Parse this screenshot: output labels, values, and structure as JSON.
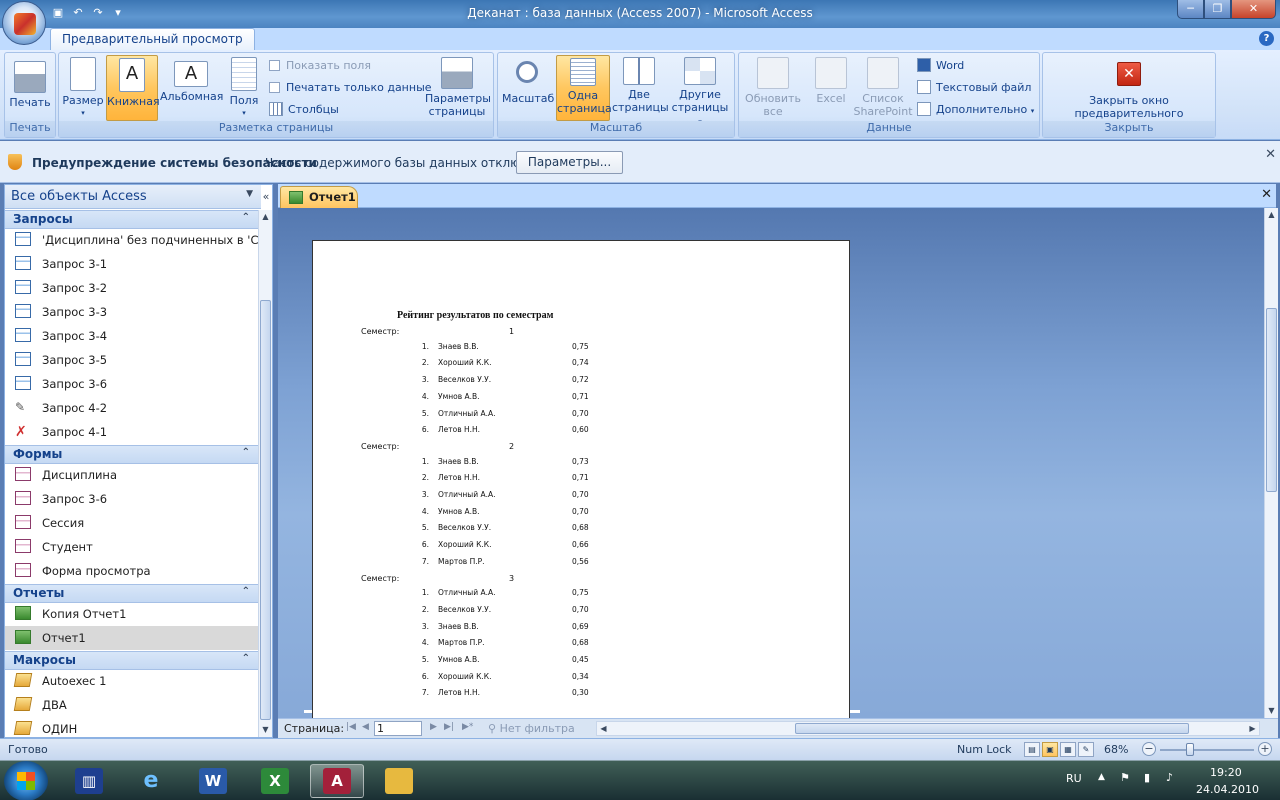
{
  "window": {
    "title": "Деканат : база данных (Access 2007) - Microsoft Access",
    "minimize": "─",
    "restore": "❐",
    "close": "✕"
  },
  "ribbon": {
    "tab": "Предварительный просмотр",
    "groups": {
      "print": {
        "label": "Печать",
        "print_btn": "Печать"
      },
      "layout": {
        "label": "Разметка страницы",
        "size_btn": "Размер",
        "portrait_btn": "Книжная",
        "landscape_btn": "Альбомная",
        "margins_btn": "Поля",
        "show_margins": "Показать поля",
        "print_data_only": "Печатать только данные",
        "columns": "Столбцы",
        "page_setup_line1": "Параметры",
        "page_setup_line2": "страницы"
      },
      "zoom": {
        "label": "Масштаб",
        "zoom_btn": "Масштаб",
        "one_page_line1": "Одна",
        "one_page_line2": "страница",
        "two_pages_line1": "Две",
        "two_pages_line2": "страницы",
        "more_pages_line1": "Другие",
        "more_pages_line2": "страницы"
      },
      "data": {
        "label": "Данные",
        "refresh_line1": "Обновить",
        "refresh_line2": "все",
        "excel": "Excel",
        "sharepoint_line1": "Список",
        "sharepoint_line2": "SharePoint",
        "word": "Word",
        "text_file": "Текстовый файл",
        "more": "Дополнительно"
      },
      "close": {
        "label": "Закрыть",
        "close_line1": "Закрыть окно",
        "close_line2": "предварительного просмотра"
      }
    }
  },
  "security": {
    "title": "Предупреждение системы безопасности",
    "message": "Часть содержимого базы данных отключено",
    "options_btn": "Параметры..."
  },
  "navpane": {
    "header": "Все объекты Access",
    "sections": [
      {
        "title": "Запросы",
        "items": [
          "'Дисциплина' без подчиненных в 'Се...",
          "Запрос 3-1",
          "Запрос 3-2",
          "Запрос 3-3",
          "Запрос 3-4",
          "Запрос 3-5",
          "Запрос 3-6",
          "Запрос 4-2",
          "Запрос 4-1"
        ]
      },
      {
        "title": "Формы",
        "items": [
          "Дисциплина",
          "Запрос 3-6",
          "Сессия",
          "Студент",
          "Форма просмотра"
        ]
      },
      {
        "title": "Отчеты",
        "items": [
          "Копия Отчет1",
          "Отчет1"
        ]
      },
      {
        "title": "Макросы",
        "items": [
          "Autoexec 1",
          "ДВА",
          "ОДИН"
        ]
      }
    ]
  },
  "document": {
    "tab": "Отчет1",
    "report": {
      "title": "Рейтинг результатов по семестрам",
      "semester_label": "Семестр:",
      "semesters": [
        {
          "num": "1",
          "rows": [
            {
              "n": "1.",
              "name": "Знаев В.В.",
              "v": "0,75"
            },
            {
              "n": "2.",
              "name": "Хороший К.К.",
              "v": "0,74"
            },
            {
              "n": "3.",
              "name": "Веселков У.У.",
              "v": "0,72"
            },
            {
              "n": "4.",
              "name": "Умнов А.В.",
              "v": "0,71"
            },
            {
              "n": "5.",
              "name": "Отличный А.А.",
              "v": "0,70"
            },
            {
              "n": "6.",
              "name": "Летов Н.Н.",
              "v": "0,60"
            }
          ]
        },
        {
          "num": "2",
          "rows": [
            {
              "n": "1.",
              "name": "Знаев В.В.",
              "v": "0,73"
            },
            {
              "n": "2.",
              "name": "Летов Н.Н.",
              "v": "0,71"
            },
            {
              "n": "3.",
              "name": "Отличный А.А.",
              "v": "0,70"
            },
            {
              "n": "4.",
              "name": "Умнов А.В.",
              "v": "0,70"
            },
            {
              "n": "5.",
              "name": "Веселков У.У.",
              "v": "0,68"
            },
            {
              "n": "6.",
              "name": "Хороший К.К.",
              "v": "0,66"
            },
            {
              "n": "7.",
              "name": "Мартов П.Р.",
              "v": "0,56"
            }
          ]
        },
        {
          "num": "3",
          "rows": [
            {
              "n": "1.",
              "name": "Отличный А.А.",
              "v": "0,75"
            },
            {
              "n": "2.",
              "name": "Веселков У.У.",
              "v": "0,70"
            },
            {
              "n": "3.",
              "name": "Знаев В.В.",
              "v": "0,69"
            },
            {
              "n": "4.",
              "name": "Мартов П.Р.",
              "v": "0,68"
            },
            {
              "n": "5.",
              "name": "Умнов А.В.",
              "v": "0,45"
            },
            {
              "n": "6.",
              "name": "Хороший К.К.",
              "v": "0,34"
            },
            {
              "n": "7.",
              "name": "Летов Н.Н.",
              "v": "0,30"
            }
          ]
        }
      ]
    },
    "pager": {
      "label": "Страница:",
      "page": "1",
      "no_filter": "Нет фильтра"
    }
  },
  "statusbar": {
    "ready": "Готово",
    "numlock": "Num Lock",
    "zoom": "68%"
  },
  "taskbar": {
    "lang": "RU",
    "time": "19:20",
    "date": "24.04.2010"
  }
}
